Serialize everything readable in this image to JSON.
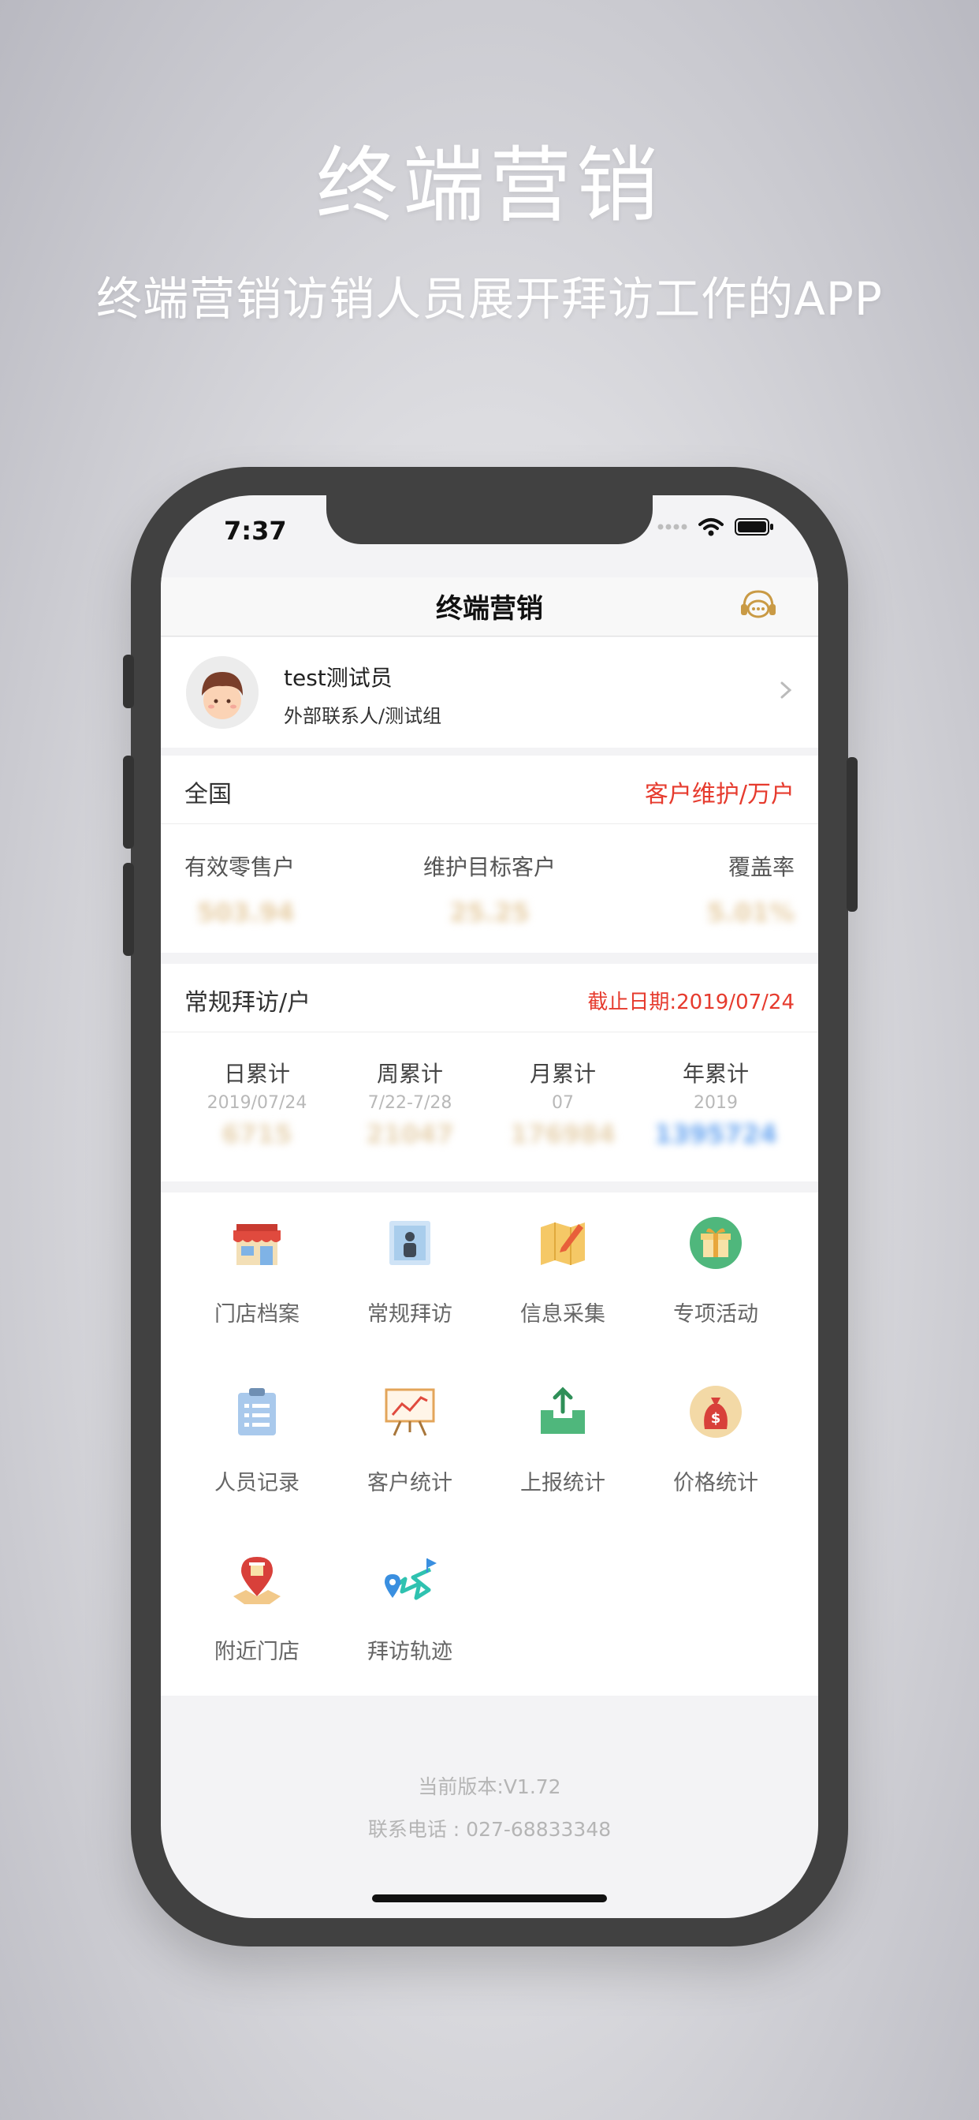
{
  "promo": {
    "title": "终端营销",
    "subtitle": "终端营销访销人员展开拜访工作的APP"
  },
  "status_bar": {
    "time": "7:37",
    "icons": [
      "signal-dots-icon",
      "wifi-icon",
      "battery-icon"
    ]
  },
  "nav": {
    "title": "终端营销",
    "service_icon": "customer-service-icon"
  },
  "profile": {
    "name": "test测试员",
    "org": "外部联系人/测试组"
  },
  "national": {
    "label": "全国",
    "unit_link": "客户维护/万户",
    "metrics": [
      {
        "label": "有效零售户",
        "value": "503.94",
        "color": "#e6cda4"
      },
      {
        "label": "维护目标客户",
        "value": "25.25",
        "color": "#e6cda4"
      },
      {
        "label": "覆盖率",
        "value": "5.01%",
        "color": "#e6cda4"
      }
    ]
  },
  "visits": {
    "label": "常规拜访/户",
    "deadline": "截止日期:2019/07/24",
    "stats": [
      {
        "title": "日累计",
        "date": "2019/07/24",
        "value": "6715",
        "color": "#e6d2b0"
      },
      {
        "title": "周累计",
        "date": "7/22-7/28",
        "value": "21047",
        "color": "#e6d2b0"
      },
      {
        "title": "月累计",
        "date": "07",
        "value": "176984",
        "color": "#e6d2b0"
      },
      {
        "title": "年累计",
        "date": "2019",
        "value": "1395724",
        "color": "#6aa6f0"
      }
    ]
  },
  "menu": [
    {
      "label": "门店档案",
      "icon": "store-icon"
    },
    {
      "label": "常规拜访",
      "icon": "visit-person-icon"
    },
    {
      "label": "信息采集",
      "icon": "map-edit-icon"
    },
    {
      "label": "专项活动",
      "icon": "gift-icon"
    },
    {
      "label": "人员记录",
      "icon": "clipboard-icon"
    },
    {
      "label": "客户统计",
      "icon": "chart-board-icon"
    },
    {
      "label": "上报统计",
      "icon": "upload-box-icon"
    },
    {
      "label": "价格统计",
      "icon": "money-bag-icon"
    },
    {
      "label": "附近门店",
      "icon": "nearby-pin-icon"
    },
    {
      "label": "拜访轨迹",
      "icon": "route-icon"
    }
  ],
  "footer": {
    "version": "当前版本:V1.72",
    "phone": "联系电话 : 027-68833348"
  }
}
